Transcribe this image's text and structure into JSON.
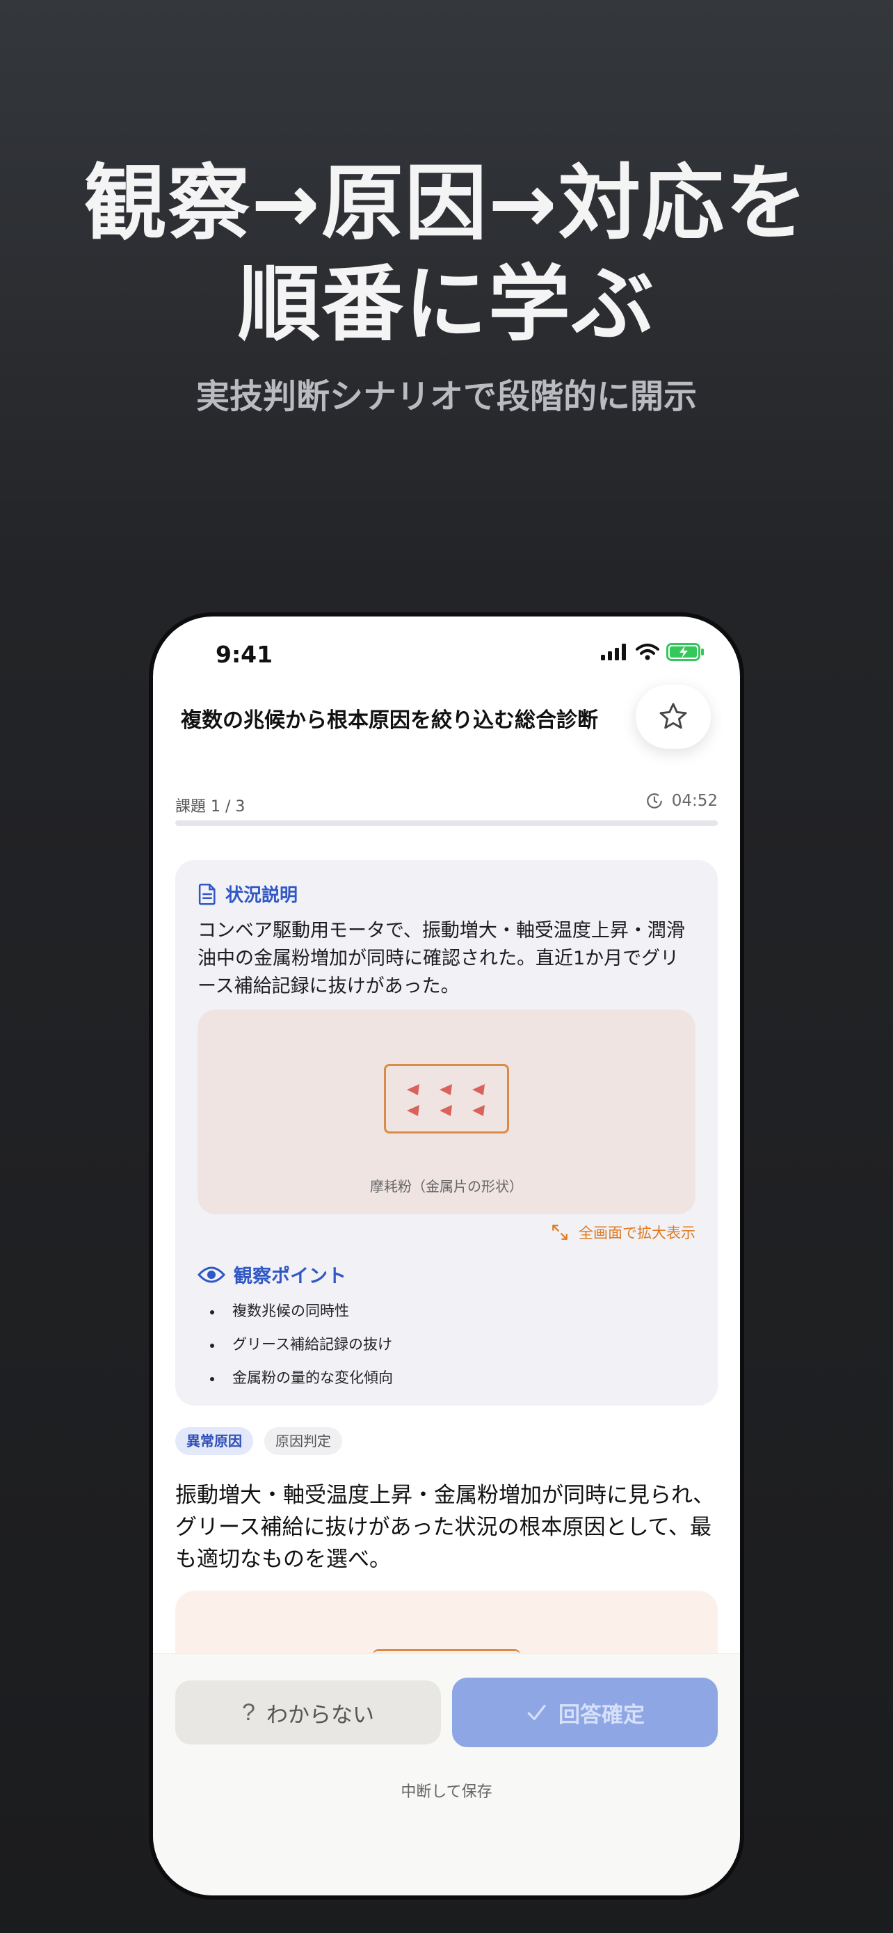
{
  "promo": {
    "headline_line1": "観察→原因→対応を",
    "headline_line2": "順番に学ぶ",
    "subheadline": "実技判断シナリオで段階的に開示"
  },
  "status_bar": {
    "time": "9:41"
  },
  "header": {
    "title": "複数の兆候から根本原因を絞り込む総合診断"
  },
  "progress": {
    "label": "課題 1 / 3",
    "current": 1,
    "total": 3,
    "timer": "04:52"
  },
  "situation": {
    "heading": "状況説明",
    "text": "コンベア駆動用モータで、振動増大・軸受温度上昇・潤滑油中の金属粉増加が同時に確認された。直近1か月でグリース補給記録に抜けがあった。",
    "image_caption": "摩耗粉（金属片の形状）",
    "fullscreen_label": "全画面で拡大表示"
  },
  "observation": {
    "heading": "観察ポイント",
    "items": [
      "複数兆候の同時性",
      "グリース補給記録の抜け",
      "金属粉の量的な変化傾向"
    ]
  },
  "tags": {
    "primary": "異常原因",
    "secondary": "原因判定"
  },
  "question": "振動増大・軸受温度上昇・金属粉増加が同時に見られ、グリース補給に抜けがあった状況の根本原因として、最も適切なものを選べ。",
  "actions": {
    "unknown_label": "わからない",
    "confirm_label": "回答確定",
    "save_label": "中断して保存"
  },
  "colors": {
    "accent": "#3057c6",
    "orange": "#e07a1f",
    "confirm_disabled": "#8ea6e3"
  }
}
